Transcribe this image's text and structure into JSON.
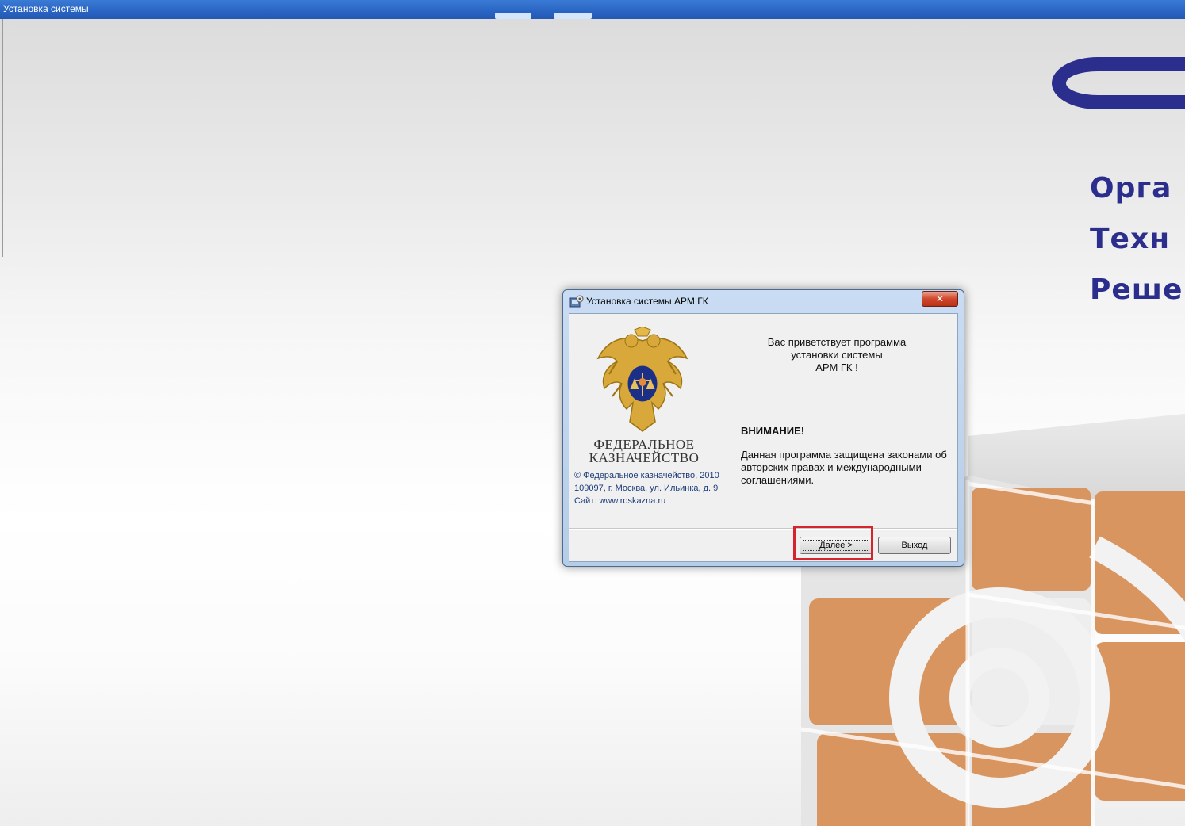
{
  "outer_window": {
    "title": "Установка системы"
  },
  "background": {
    "brand_lines": [
      "Орга",
      "Техн",
      "Реше"
    ],
    "brand_color": "#2b2e8c",
    "cube_color": "#d9955f"
  },
  "dialog": {
    "title": "Установка системы АРМ ГК",
    "close_label": "✕",
    "org_name": [
      "ФЕДЕРАЛЬНОЕ",
      "КАЗНАЧЕЙСТВО"
    ],
    "copyright": [
      "© Федеральное казначейство, 2010",
      "109097, г. Москва, ул. Ильинка, д. 9",
      "Сайт: www.roskazna.ru"
    ],
    "welcome": [
      "Вас приветствует программа",
      "установки  системы",
      "АРМ ГК !"
    ],
    "warning_title": "ВНИМАНИЕ!",
    "warning_text": "Данная программа защищена законами об авторских правах и международными соглашениями.",
    "buttons": {
      "next": "Далее >",
      "exit": "Выход"
    }
  },
  "annotation": {
    "highlight_color": "#d6242c"
  }
}
